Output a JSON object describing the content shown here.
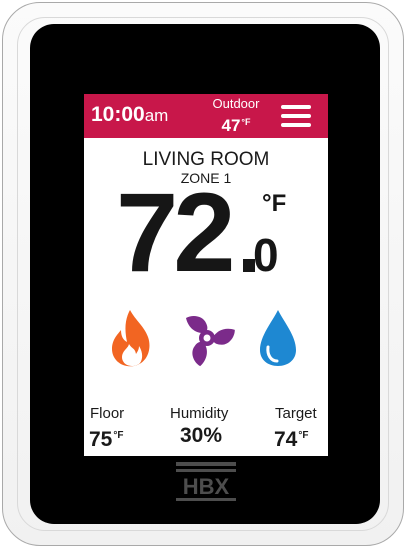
{
  "header": {
    "time": "10:00",
    "ampm": "am",
    "outdoor_label": "Outdoor",
    "outdoor_value": "47",
    "outdoor_unit": "°F"
  },
  "room": {
    "name": "LIVING ROOM",
    "zone": "ZONE 1"
  },
  "temperature": {
    "integer": "72",
    "decimal": "0",
    "unit": "°F"
  },
  "modes": {
    "icons": [
      "flame-icon",
      "fan-icon",
      "water-drop-icon"
    ],
    "heat_color": "#f26522",
    "fan_color": "#7b2b8a",
    "humidity_color": "#1e88d2"
  },
  "readings": {
    "floor_label": "Floor",
    "floor_value": "75",
    "floor_unit": "°F",
    "humidity_label": "Humidity",
    "humidity_value": "30%",
    "target_label": "Target",
    "target_value": "74",
    "target_unit": "°F"
  },
  "brand": {
    "logo_text": "HBX"
  },
  "colors": {
    "header_bg": "#c8174a",
    "bezel": "#000000",
    "logo": "#4d4d4d"
  }
}
